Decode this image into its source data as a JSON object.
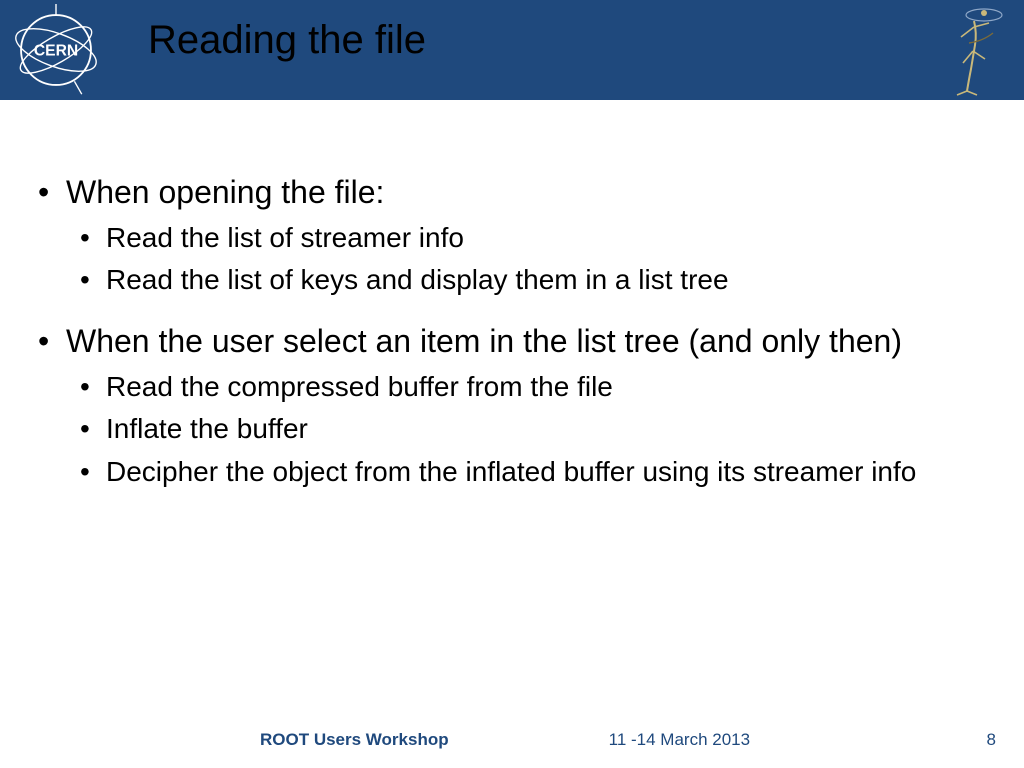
{
  "header": {
    "title": "Reading the file",
    "logo_left_alt": "CERN",
    "logo_right_alt": "ROOT figure"
  },
  "body": {
    "items": [
      {
        "text": "When opening the file:",
        "children": [
          {
            "text": "Read the list of streamer info"
          },
          {
            "text": "Read the list of keys and display them in a list tree"
          }
        ]
      },
      {
        "text": "When the user select an item in the list tree (and only then)",
        "children": [
          {
            "text": "Read the compressed buffer from the file"
          },
          {
            "text": "Inflate the buffer"
          },
          {
            "text": "Decipher the object from the inflated buffer using its streamer info"
          }
        ]
      }
    ]
  },
  "footer": {
    "venue": "ROOT Users Workshop",
    "date": "11 -14 March 2013",
    "page": "8"
  }
}
